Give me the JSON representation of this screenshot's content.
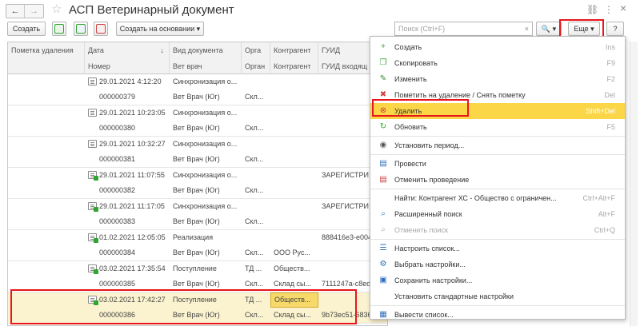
{
  "window": {
    "title": "АСП Ветеринарный документ",
    "back_arrow": "←",
    "forward_arrow": "→",
    "star": "☆",
    "link_icon": "⛓",
    "more_icon": "⋮",
    "close_icon": "×"
  },
  "toolbar": {
    "create": "Создать",
    "based_on": "Создать на основании ▾",
    "search_placeholder": "Поиск (Ctrl+F)",
    "search_clear": "×",
    "search_go": "🔍 ▾",
    "more": "Еще ▾",
    "help": "?"
  },
  "table": {
    "headers_top": [
      "Пометка удаления",
      "Дата",
      "Вид документа",
      "Орга",
      "Контрагент",
      "ГУИД"
    ],
    "headers_bottom": [
      "",
      "Номер",
      "Вет врач",
      "Орган",
      "Контрагент",
      "ГУИД входящ"
    ],
    "sort_indicator": "↓",
    "rows": [
      {
        "date": "29.01.2021 4:12:20",
        "kind": "Синхронизация о...",
        "org": "",
        "contr": "",
        "guid": "",
        "num": "000000379",
        "vet": "Вет Врач (Юг)",
        "org2": "Скл...",
        "contr2": "",
        "guid2": "",
        "posted": false
      },
      {
        "date": "29.01.2021 10:23:05",
        "kind": "Синхронизация о...",
        "org": "",
        "contr": "",
        "guid": "",
        "num": "000000380",
        "vet": "Вет Врач (Юг)",
        "org2": "Скл...",
        "contr2": "",
        "guid2": "",
        "posted": false
      },
      {
        "date": "29.01.2021 10:32:27",
        "kind": "Синхронизация о...",
        "org": "",
        "contr": "",
        "guid": "",
        "num": "000000381",
        "vet": "Вет Врач (Юг)",
        "org2": "Скл...",
        "contr2": "",
        "guid2": "",
        "posted": false
      },
      {
        "date": "29.01.2021 11:07:55",
        "kind": "Синхронизация о...",
        "org": "",
        "contr": "",
        "guid": "ЗАРЕГИСТРИ",
        "num": "000000382",
        "vet": "Вет Врач (Юг)",
        "org2": "Скл...",
        "contr2": "",
        "guid2": "",
        "posted": true
      },
      {
        "date": "29.01.2021 11:17:05",
        "kind": "Синхронизация о...",
        "org": "",
        "contr": "",
        "guid": "ЗАРЕГИСТРИ",
        "num": "000000383",
        "vet": "Вет Врач (Юг)",
        "org2": "Скл...",
        "contr2": "",
        "guid2": "",
        "posted": true
      },
      {
        "date": "01.02.2021 12:05:05",
        "kind": "Реализация",
        "org": "",
        "contr": "",
        "guid": "888416e3-e004",
        "num": "000000384",
        "vet": "Вет Врач (Юг)",
        "org2": "Скл...",
        "contr2": "ООО Рус...",
        "guid2": "",
        "posted": true
      },
      {
        "date": "03.02.2021 17:35:54",
        "kind": "Поступление",
        "org": "ТД ...",
        "contr": "Обществ...",
        "guid": "",
        "num": "000000385",
        "vet": "Вет Врач (Юг)",
        "org2": "Скл...",
        "contr2": "Склад сы...",
        "guid2": "7111247a-c8ed",
        "posted": true
      },
      {
        "date": "03.02.2021 17:42:27",
        "kind": "Поступление",
        "org": "ТД ...",
        "contr": "Обществ...",
        "guid": "",
        "num": "000000386",
        "vet": "Вет Врач (Юг)",
        "org2": "Скл...",
        "contr2": "Склад сы...",
        "guid2": "9b73ec51-6836",
        "posted": true
      }
    ]
  },
  "menu": {
    "items": [
      {
        "label": "Создать",
        "shortcut": "Ins",
        "icon": "plus-circle-icon",
        "glyph": "+",
        "color": "#2fa52f",
        "disabled": false
      },
      {
        "label": "Скопировать",
        "shortcut": "F9",
        "icon": "copy-icon",
        "glyph": "❐",
        "color": "#2fa52f",
        "disabled": false
      },
      {
        "label": "Изменить",
        "shortcut": "F2",
        "icon": "pencil-icon",
        "glyph": "✎",
        "color": "#2f8f2f",
        "disabled": false
      },
      {
        "label": "Пометить на удаление / Снять пометку",
        "shortcut": "Del",
        "icon": "mark-delete-icon",
        "glyph": "✖",
        "color": "#d04040",
        "disabled": false
      },
      {
        "label": "Удалить",
        "shortcut": "Shift+Del",
        "icon": "delete-icon",
        "glyph": "⊗",
        "color": "#d04040",
        "disabled": false
      },
      {
        "label": "Обновить",
        "shortcut": "F5",
        "icon": "refresh-icon",
        "glyph": "↻",
        "color": "#2fa52f",
        "disabled": false
      },
      {
        "label": "Установить период...",
        "shortcut": "",
        "icon": "period-icon",
        "glyph": "◉",
        "color": "#555555",
        "disabled": false
      },
      {
        "label": "Провести",
        "shortcut": "",
        "icon": "post-icon",
        "glyph": "▤",
        "color": "#2f6fb8",
        "disabled": false
      },
      {
        "label": "Отменить проведение",
        "shortcut": "",
        "icon": "unpost-icon",
        "glyph": "▤",
        "color": "#d04040",
        "disabled": false
      },
      {
        "label": "Найти: Контрагент ХС - Общество с ограничен...",
        "shortcut": "Ctrl+Alt+F",
        "icon": "",
        "glyph": "",
        "color": "#555555",
        "disabled": false
      },
      {
        "label": "Расширенный поиск",
        "shortcut": "Alt+F",
        "icon": "search-icon",
        "glyph": "⌕",
        "color": "#2f6fb8",
        "disabled": false
      },
      {
        "label": "Отменить поиск",
        "shortcut": "Ctrl+Q",
        "icon": "cancel-search-icon",
        "glyph": "⌕",
        "color": "#a8a8a8",
        "disabled": true
      },
      {
        "label": "Настроить список...",
        "shortcut": "",
        "icon": "list-settings-icon",
        "glyph": "☰",
        "color": "#2f6fb8",
        "disabled": false
      },
      {
        "label": "Выбрать настройки...",
        "shortcut": "",
        "icon": "choose-settings-icon",
        "glyph": "⚙",
        "color": "#2f6fb8",
        "disabled": false
      },
      {
        "label": "Сохранить настройки...",
        "shortcut": "",
        "icon": "save-settings-icon",
        "glyph": "▣",
        "color": "#2f6fb8",
        "disabled": false
      },
      {
        "label": "Установить стандартные настройки",
        "shortcut": "",
        "icon": "",
        "glyph": "",
        "color": "#555555",
        "disabled": false
      },
      {
        "label": "Вывести список...",
        "shortcut": "",
        "icon": "print-list-icon",
        "glyph": "▦",
        "color": "#2f6fb8",
        "disabled": false
      }
    ]
  },
  "colors": {
    "highlight_red": "#e8161b",
    "menu_highlight": "#fbd646",
    "selected_row": "#fbf3cf"
  }
}
